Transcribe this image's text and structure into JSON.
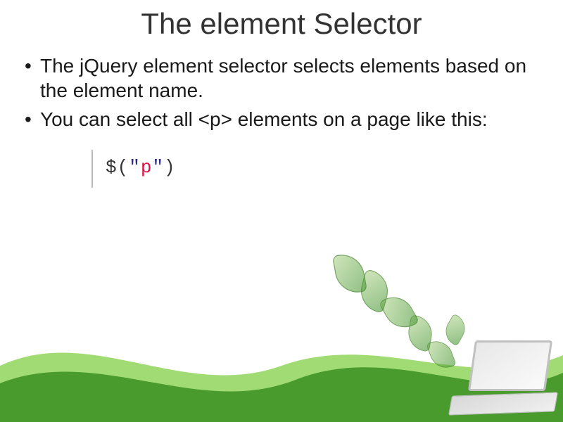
{
  "title": "The element Selector",
  "bullets": [
    "The jQuery element selector selects elements based on the element name.",
    "You can select all <p> elements on a page like this:"
  ],
  "code": {
    "dollar": "$",
    "open_paren": "(",
    "quote1": "\"",
    "value": "p",
    "quote2": "\"",
    "close_paren": ")"
  },
  "colors": {
    "wave_dark": "#4a9b2e",
    "wave_light": "#8fd65a"
  }
}
